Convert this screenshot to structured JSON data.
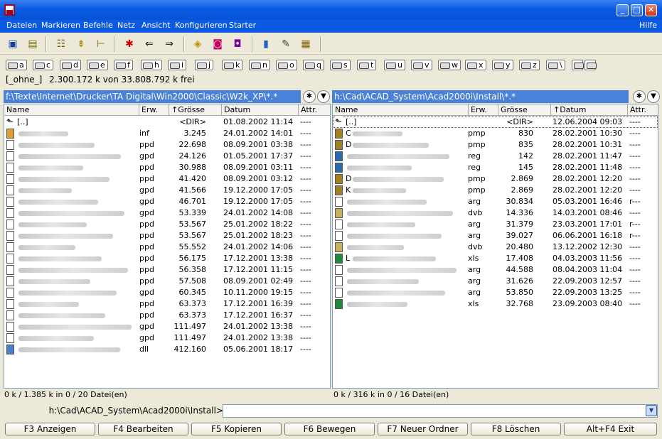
{
  "window": {
    "controls": [
      "_",
      "□",
      "✕"
    ]
  },
  "menu": {
    "items": [
      "Dateien",
      "Markieren",
      "Befehle",
      "Netz",
      "Ansicht",
      "Konfigurieren",
      "Starter"
    ],
    "help": "Hilfe"
  },
  "toolbar": {
    "icons": [
      "save-icon",
      "compare-icon",
      "select-icon",
      "unpack-icon",
      "tree-icon",
      "star-icon",
      "back-arrow-icon",
      "forward-arrow-icon",
      "package-icon",
      "ftp-icon",
      "nc-icon",
      "notes-icon",
      "edit-icon",
      "image-icon"
    ]
  },
  "drives": [
    "a",
    "c",
    "d",
    "e",
    "f",
    "h",
    "i",
    "j",
    "k",
    "n",
    "o",
    "q",
    "s",
    "t",
    "u",
    "v",
    "w",
    "x",
    "y",
    "z",
    "\\",
    "..",
    ".."
  ],
  "free_info": {
    "label": "[_ohne_]",
    "text": "2.300.172 k von 33.808.792 k frei"
  },
  "left": {
    "path": "f:\\Texte\\Internet\\Drucker\\TA Digital\\Win2000\\Classic\\W2k_XP\\*.*",
    "headers": [
      "Name",
      "Erw.",
      "↑Grösse",
      "Datum",
      "Attr."
    ],
    "parent": {
      "name": "[..]",
      "size": "<DIR>",
      "date": "01.08.2002 11:14",
      "attr": "----"
    },
    "rows": [
      {
        "ext": "inf",
        "size": "3.245",
        "date": "24.01.2002 14:01",
        "attr": "----"
      },
      {
        "ext": "ppd",
        "size": "22.698",
        "date": "08.09.2001 03:38",
        "attr": "----"
      },
      {
        "ext": "gpd",
        "size": "24.126",
        "date": "01.05.2001 17:37",
        "attr": "----"
      },
      {
        "ext": "ppd",
        "size": "30.988",
        "date": "08.09.2001 03:11",
        "attr": "----"
      },
      {
        "ext": "ppd",
        "size": "41.420",
        "date": "08.09.2001 03:12",
        "attr": "----"
      },
      {
        "ext": "gpd",
        "size": "41.566",
        "date": "19.12.2000 17:05",
        "attr": "----"
      },
      {
        "ext": "gpd",
        "size": "46.701",
        "date": "19.12.2000 17:05",
        "attr": "----"
      },
      {
        "ext": "gpd",
        "size": "53.339",
        "date": "24.01.2002 14:08",
        "attr": "----"
      },
      {
        "ext": "ppd",
        "size": "53.567",
        "date": "25.01.2002 18:22",
        "attr": "----"
      },
      {
        "ext": "ppd",
        "size": "53.567",
        "date": "25.01.2002 18:23",
        "attr": "----"
      },
      {
        "ext": "ppd",
        "size": "55.552",
        "date": "24.01.2002 14:06",
        "attr": "----"
      },
      {
        "ext": "ppd",
        "size": "56.175",
        "date": "17.12.2001 13:38",
        "attr": "----"
      },
      {
        "ext": "ppd",
        "size": "56.358",
        "date": "17.12.2001 11:15",
        "attr": "----"
      },
      {
        "ext": "ppd",
        "size": "57.508",
        "date": "08.09.2001 02:49",
        "attr": "----"
      },
      {
        "ext": "gpd",
        "size": "60.345",
        "date": "10.11.2000 19:15",
        "attr": "----"
      },
      {
        "ext": "ppd",
        "size": "63.373",
        "date": "17.12.2001 16:39",
        "attr": "----"
      },
      {
        "ext": "ppd",
        "size": "63.373",
        "date": "17.12.2001 16:37",
        "attr": "----"
      },
      {
        "ext": "gpd",
        "size": "111.497",
        "date": "24.01.2002 13:38",
        "attr": "----"
      },
      {
        "ext": "gpd",
        "size": "111.497",
        "date": "24.01.2002 13:38",
        "attr": "----"
      },
      {
        "ext": "dll",
        "size": "412.160",
        "date": "05.06.2001 18:17",
        "attr": "----"
      }
    ],
    "status": "0 k / 1.385 k in 0 / 20 Datei(en)"
  },
  "right": {
    "path": "h:\\Cad\\ACAD_System\\Acad2000i\\Install\\*.*",
    "headers": [
      "Name",
      "Erw.",
      "Grösse",
      "↑Datum",
      "Attr."
    ],
    "parent": {
      "name": "[..]",
      "size": "<DIR>",
      "date": "12.06.2004 09:03",
      "attr": "----"
    },
    "rows": [
      {
        "name": "C",
        "ext": "pmp",
        "size": "830",
        "date": "28.02.2001 10:30",
        "attr": "----"
      },
      {
        "name": "D",
        "ext": "pmp",
        "size": "835",
        "date": "28.02.2001 10:31",
        "attr": "----"
      },
      {
        "name": "",
        "ext": "reg",
        "size": "142",
        "date": "28.02.2001 11:47",
        "attr": "----"
      },
      {
        "name": "",
        "ext": "reg",
        "size": "145",
        "date": "28.02.2001 11:48",
        "attr": "----"
      },
      {
        "name": "D",
        "ext": "pmp",
        "size": "2.869",
        "date": "28.02.2001 12:20",
        "attr": "----"
      },
      {
        "name": "K",
        "ext": "pmp",
        "size": "2.869",
        "date": "28.02.2001 12:20",
        "attr": "----"
      },
      {
        "name": "",
        "ext": "arg",
        "size": "30.834",
        "date": "05.03.2001 16:46",
        "attr": "r---"
      },
      {
        "name": "",
        "ext": "dvb",
        "size": "14.336",
        "date": "14.03.2001 08:46",
        "attr": "----"
      },
      {
        "name": "",
        "ext": "arg",
        "size": "31.379",
        "date": "23.03.2001 17:01",
        "attr": "r---"
      },
      {
        "name": "",
        "ext": "arg",
        "size": "39.027",
        "date": "06.06.2001 16:18",
        "attr": "r---"
      },
      {
        "name": "",
        "ext": "dvb",
        "size": "20.480",
        "date": "13.12.2002 12:30",
        "attr": "----"
      },
      {
        "name": "L",
        "ext": "xls",
        "size": "17.408",
        "date": "04.03.2003 11:56",
        "attr": "----"
      },
      {
        "name": "",
        "ext": "arg",
        "size": "44.588",
        "date": "08.04.2003 11:04",
        "attr": "----"
      },
      {
        "name": "",
        "ext": "arg",
        "size": "31.626",
        "date": "22.09.2003 12:57",
        "attr": "----"
      },
      {
        "name": "",
        "ext": "arg",
        "size": "53.850",
        "date": "22.09.2003 13:25",
        "attr": "----"
      },
      {
        "name": "",
        "ext": "xls",
        "size": "32.768",
        "date": "23.09.2003 08:40",
        "attr": "----"
      }
    ],
    "status": "0 k / 316 k in 0 / 16 Datei(en)"
  },
  "command": {
    "label": "h:\\Cad\\ACAD_System\\Acad2000i\\Install>",
    "value": ""
  },
  "fkeys": [
    "F3 Anzeigen",
    "F4 Bearbeiten",
    "F5 Kopieren",
    "F6 Bewegen",
    "F7 Neuer Ordner",
    "F8 Löschen",
    "Alt+F4 Exit"
  ]
}
